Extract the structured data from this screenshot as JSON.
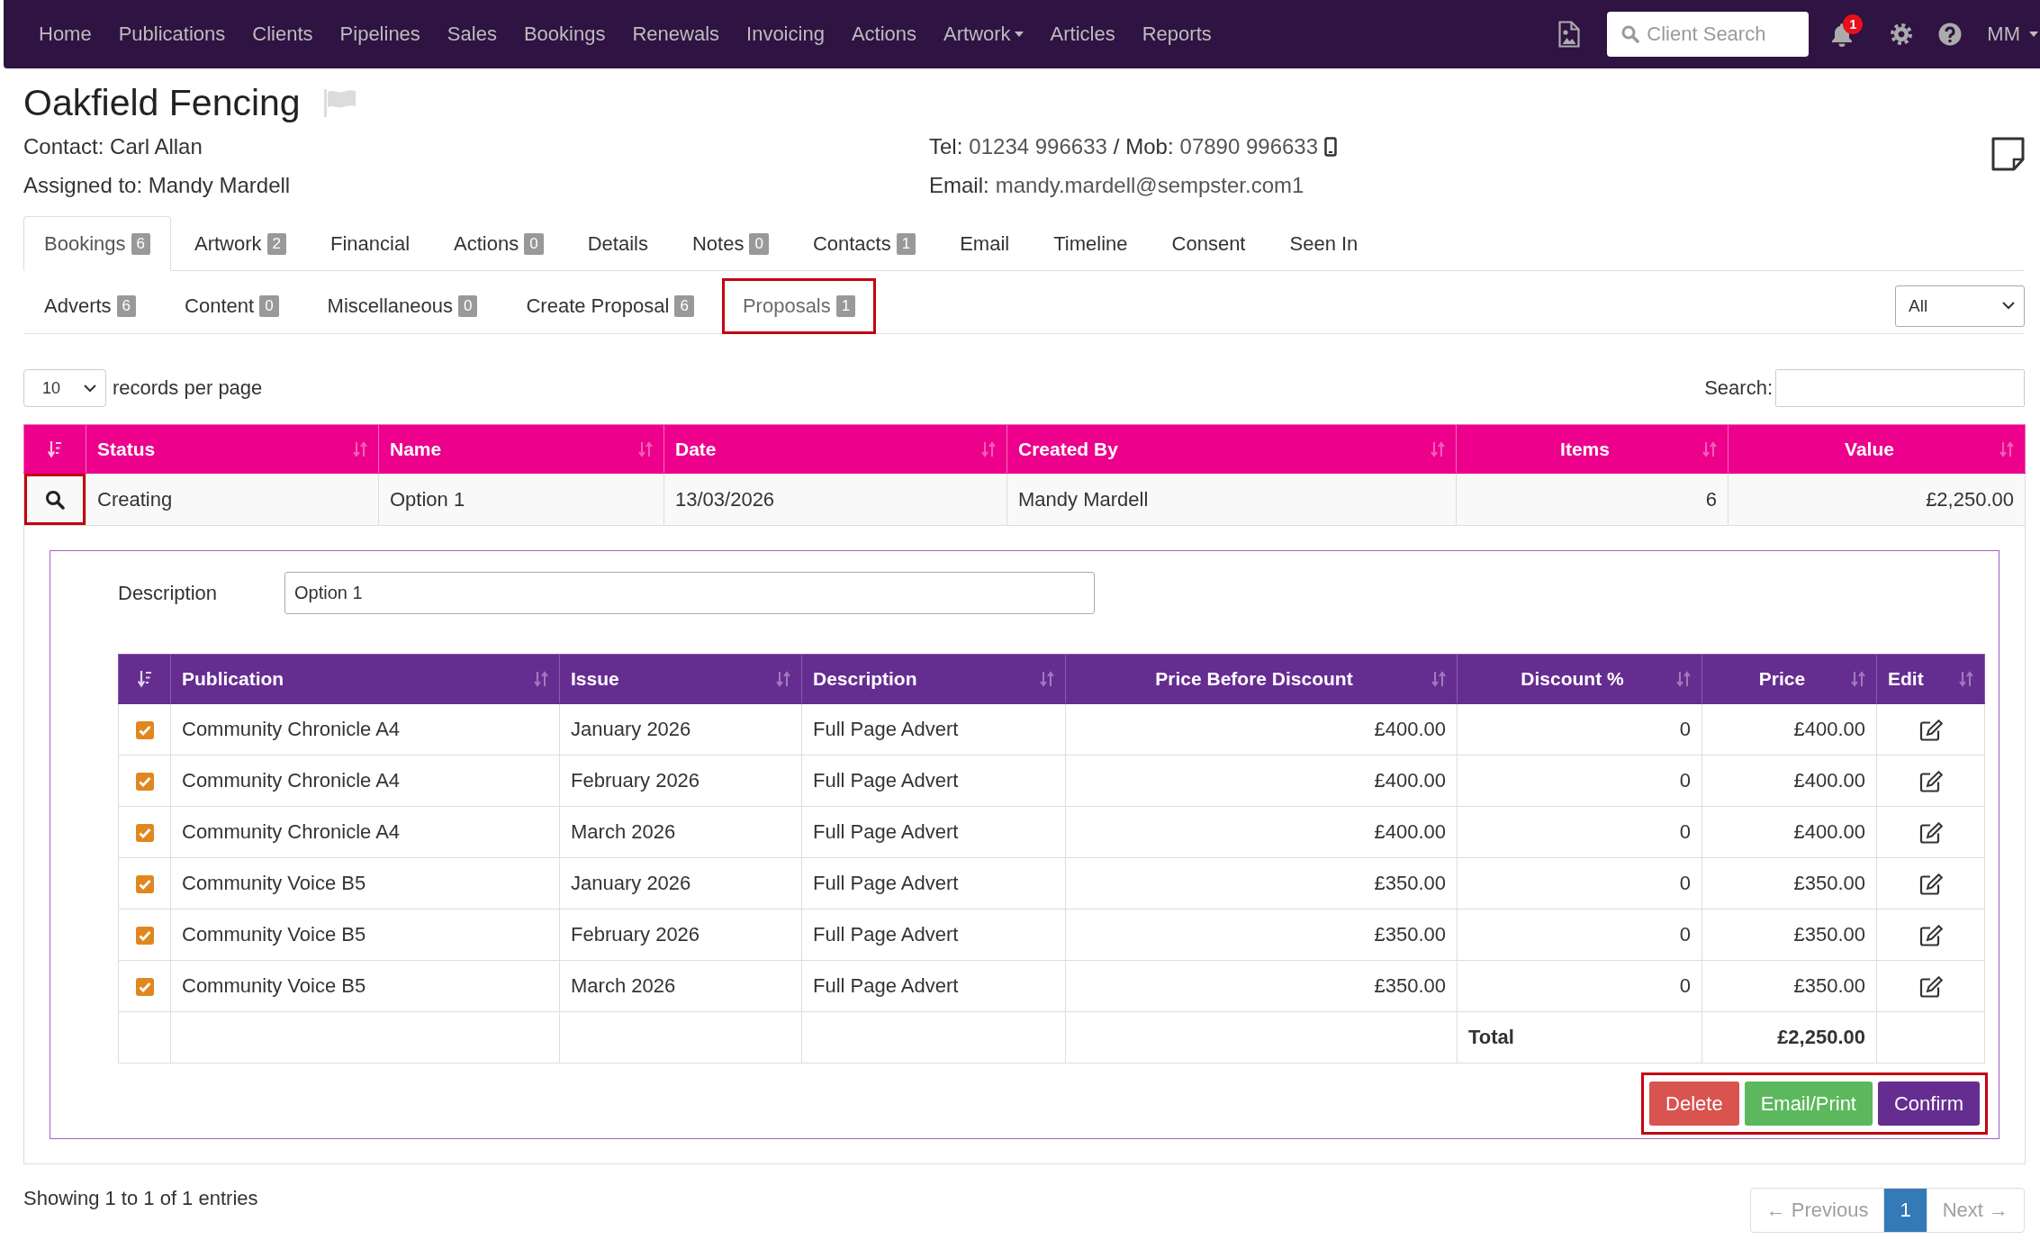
{
  "nav": {
    "items": [
      {
        "label": "Home",
        "dropdown": false
      },
      {
        "label": "Publications",
        "dropdown": false
      },
      {
        "label": "Clients",
        "dropdown": false
      },
      {
        "label": "Pipelines",
        "dropdown": false
      },
      {
        "label": "Sales",
        "dropdown": false
      },
      {
        "label": "Bookings",
        "dropdown": false
      },
      {
        "label": "Renewals",
        "dropdown": false
      },
      {
        "label": "Invoicing",
        "dropdown": false
      },
      {
        "label": "Actions",
        "dropdown": false
      },
      {
        "label": "Artwork",
        "dropdown": true
      },
      {
        "label": "Articles",
        "dropdown": false
      },
      {
        "label": "Reports",
        "dropdown": false
      }
    ],
    "search": {
      "placeholder": "Client Search"
    },
    "notifications": {
      "count": "1"
    },
    "user": {
      "initials": "MM"
    }
  },
  "client": {
    "name": "Oakfield Fencing",
    "contact": "Contact: Carl Allan",
    "assigned": "Assigned to: Mandy Mardell",
    "phone": {
      "tel_label": "Tel:",
      "tel": "01234 996633",
      "mob_label": "/ Mob:",
      "mob": "07890 996633"
    },
    "email": {
      "label": "Email:",
      "address": "mandy.mardell@sempster.com1"
    }
  },
  "tabs": [
    {
      "label": "Bookings",
      "count": "6",
      "selected": true
    },
    {
      "label": "Artwork",
      "count": "2",
      "selected": false
    },
    {
      "label": "Financial",
      "selected": false
    },
    {
      "label": "Actions",
      "count": "0",
      "selected": false
    },
    {
      "label": "Details",
      "selected": false
    },
    {
      "label": "Notes",
      "count": "0",
      "selected": false
    },
    {
      "label": "Contacts",
      "count": "1",
      "selected": false
    },
    {
      "label": "Email",
      "selected": false
    },
    {
      "label": "Timeline",
      "selected": false
    },
    {
      "label": "Consent",
      "selected": false
    },
    {
      "label": "Seen In",
      "selected": false
    }
  ],
  "subtabs": [
    {
      "label": "Adverts",
      "count": "6",
      "selected": false,
      "highlighted": false
    },
    {
      "label": "Content",
      "count": "0",
      "selected": false,
      "highlighted": false
    },
    {
      "label": "Miscellaneous",
      "count": "0",
      "selected": false,
      "highlighted": false
    },
    {
      "label": "Create Proposal",
      "count": "6",
      "selected": false,
      "highlighted": false
    },
    {
      "label": "Proposals",
      "count": "1",
      "selected": true,
      "highlighted": true
    }
  ],
  "filter": {
    "value": "All"
  },
  "table": {
    "page_size": "10",
    "page_size_label": "records per page",
    "search_label": "Search:",
    "columns": [
      {
        "kind": "control",
        "sorted": true
      },
      {
        "label": "Status",
        "kind": "text",
        "sorted": false
      },
      {
        "label": "Name",
        "kind": "text",
        "sorted": false
      },
      {
        "label": "Date",
        "kind": "text",
        "sorted": false
      },
      {
        "label": "Created By",
        "kind": "text",
        "sorted": false
      },
      {
        "label": "Items",
        "kind": "number",
        "sorted": false
      },
      {
        "label": "Value",
        "kind": "number",
        "sorted": false
      }
    ],
    "rows": [
      {
        "cells": [
          "",
          "Creating",
          "Option 1",
          "13/03/2026",
          "Mandy Mardell",
          "6",
          "£2,250.00"
        ],
        "highlighted": true,
        "expanded": true,
        "detail": {
          "description_label": "Description",
          "description": "Option 1",
          "columns": [
            {
              "kind": "control",
              "sorted": true
            },
            {
              "label": "Publication",
              "kind": "text",
              "sorted": false
            },
            {
              "label": "Issue",
              "kind": "text",
              "sorted": false
            },
            {
              "label": "Description",
              "kind": "text",
              "sorted": false
            },
            {
              "label": "Price Before Discount",
              "kind": "number",
              "sorted": false
            },
            {
              "label": "Discount %",
              "kind": "number",
              "sorted": false
            },
            {
              "label": "Price",
              "kind": "number",
              "sorted": false
            },
            {
              "label": "Edit",
              "kind": "action",
              "sorted": false
            }
          ],
          "rows": [
            {
              "checked": true,
              "cells": [
                "",
                "Community Chronicle A4",
                "January 2026",
                "Full Page Advert",
                "£400.00",
                "0",
                "£400.00"
              ]
            },
            {
              "checked": true,
              "cells": [
                "",
                "Community Chronicle A4",
                "February 2026",
                "Full Page Advert",
                "£400.00",
                "0",
                "£400.00"
              ]
            },
            {
              "checked": true,
              "cells": [
                "",
                "Community Chronicle A4",
                "March 2026",
                "Full Page Advert",
                "£400.00",
                "0",
                "£400.00"
              ]
            },
            {
              "checked": true,
              "cells": [
                "",
                "Community Voice B5",
                "January 2026",
                "Full Page Advert",
                "£350.00",
                "0",
                "£350.00"
              ]
            },
            {
              "checked": true,
              "cells": [
                "",
                "Community Voice B5",
                "February 2026",
                "Full Page Advert",
                "£350.00",
                "0",
                "£350.00"
              ]
            },
            {
              "checked": true,
              "cells": [
                "",
                "Community Voice B5",
                "March 2026",
                "Full Page Advert",
                "£350.00",
                "0",
                "£350.00"
              ]
            }
          ],
          "total_label": "Total",
          "total": "£2,250.00",
          "buttons": [
            {
              "label": "Delete",
              "kind": "danger"
            },
            {
              "label": "Email/Print",
              "kind": "success"
            },
            {
              "label": "Confirm",
              "kind": "primary"
            }
          ],
          "actions_highlighted": true
        }
      }
    ],
    "info": "Showing 1 to 1 of 1 entries",
    "pagination": [
      {
        "label": "← Previous",
        "selected": false,
        "disabled": true
      },
      {
        "label": "1",
        "selected": true,
        "disabled": false
      },
      {
        "label": "Next →",
        "selected": false,
        "disabled": true
      }
    ]
  }
}
